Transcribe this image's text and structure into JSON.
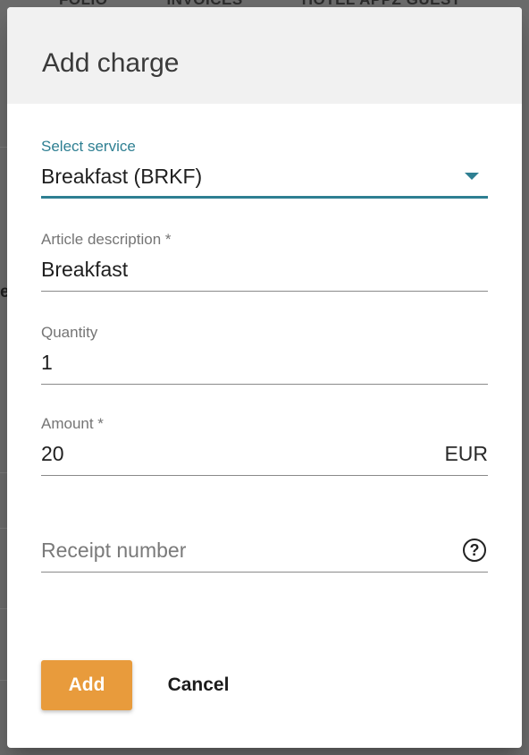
{
  "background": {
    "tabs": [
      "FOLIO",
      "INVOICES",
      "HOTEL APPZ GUEST"
    ],
    "edge_letter": "e"
  },
  "dialog": {
    "title": "Add charge",
    "service": {
      "label": "Select service",
      "value": "Breakfast (BRKF)"
    },
    "article_description": {
      "label": "Article description *",
      "value": "Breakfast"
    },
    "quantity": {
      "label": "Quantity",
      "value": "1"
    },
    "amount": {
      "label": "Amount *",
      "value": "20",
      "currency": "EUR"
    },
    "receipt_number": {
      "placeholder": "Receipt number",
      "help_icon": "help-circle-icon"
    },
    "buttons": {
      "add": "Add",
      "cancel": "Cancel"
    }
  },
  "colors": {
    "accent": "#2e7f92",
    "primary_button": "#e89b3c",
    "header_bg": "#f1f1f1"
  }
}
